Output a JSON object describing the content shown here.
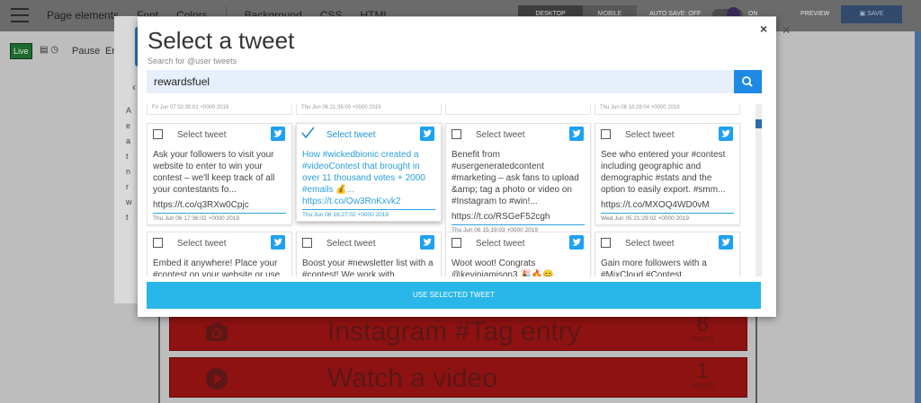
{
  "topbar": {
    "nav": [
      "Page elements",
      "Font",
      "Colors",
      "Background",
      "CSS",
      "HTML"
    ],
    "view_desktop": "DESKTOP",
    "view_mobile": "MOBILE",
    "autosave_label": "AUTO SAVE: OFF",
    "toggle_label": "ON",
    "preview_label": "PREVIEW",
    "save_label": "SAVE"
  },
  "toolbar": {
    "live_label": "Live",
    "pause_label": "Pause",
    "en_label": "En"
  },
  "entries": [
    {
      "icon": "camera-icon",
      "title": "Instagram #Tag entry",
      "points": "6",
      "points_label": "POINTS"
    },
    {
      "icon": "play-icon",
      "title": "Watch a video",
      "points": "1",
      "points_label": "POINTS"
    }
  ],
  "modal": {
    "title": "Select a tweet",
    "subtitle": "Search for @user tweets",
    "search_value": "rewardsfuel",
    "use_button": "USE SELECTED TWEET",
    "stub_dates": [
      "Fri Jun 07 02:30:01 +0000 2019",
      "Thu Jun 06 21:35:00 +0000 2019",
      "",
      "Thu Jun 06 18:28:04 +0000 2019"
    ],
    "select_label": "Select tweet",
    "row1": [
      {
        "text": "Ask your followers to visit your website to enter to win your contest – we'll keep track of all your contestants fo...",
        "link": "https://t.co/q3RXw0Cpjc",
        "date": "Thu Jun 06 17:36:02 +0000 2019",
        "selected": false
      },
      {
        "text": "How #wickedbionic created a #videoContest that brought in over 11 thousand votes + 2000 #emails 💰... https://t.co/Ow3RnKxvk2",
        "link": "",
        "date": "Thu Jun 06 16:27:02 +0000 2019",
        "selected": true
      },
      {
        "text": "Benefit from #usergeneratedcontent #marketing – ask fans to upload &amp; tag a photo or video on #Instagram to #win!...",
        "link": "https://t.co/RSGeF52cgh",
        "date": "Thu Jun 06 15:19:03 +0000 2019",
        "selected": false
      },
      {
        "text": "See who entered your #contest including geographic and demographic #stats and the option to easily export. #smm...",
        "link": "https://t.co/MXOQ4WD0vM",
        "date": "Wed Jun 05 21:29:02 +0000 2019",
        "selected": false
      }
    ],
    "row2": [
      {
        "text": "Embed it anywhere! Place your #contest on your website or use our"
      },
      {
        "text": "Boost your #newsletter list with a #contest! We work with #mailchimp"
      },
      {
        "text": "Woot woot! Congrats @kevinjamison3 🎉🔥😊"
      },
      {
        "text": "Gain more followers with a #MixCloud #Contest..."
      }
    ]
  },
  "colors": {
    "accent": "#29b6e8",
    "search_button": "#1e88e5",
    "twitter": "#1da1f2",
    "entry_bg": "#8e1212"
  }
}
